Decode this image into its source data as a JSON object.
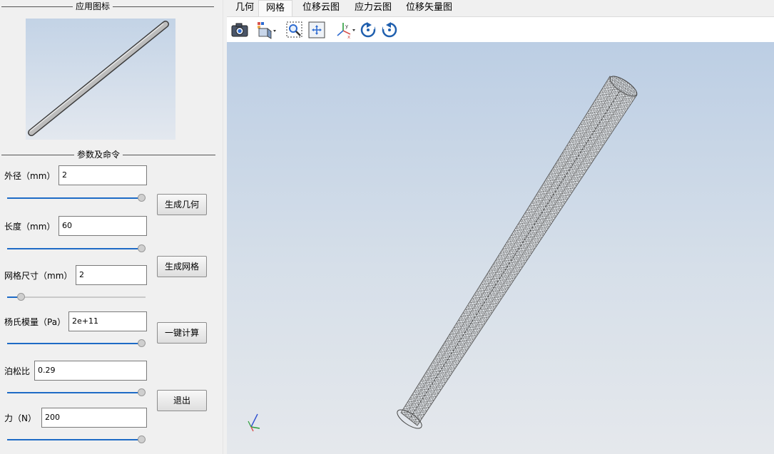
{
  "left_panel": {
    "icon_group_title": "应用图标",
    "params_group_title": "参数及命令",
    "params": {
      "outer_diameter": {
        "label": "外径（mm）",
        "value": "2",
        "slider_fraction": 1.0
      },
      "length": {
        "label": "长度（mm）",
        "value": "60",
        "slider_fraction": 1.0
      },
      "mesh_size": {
        "label": "网格尺寸（mm）",
        "value": "2",
        "slider_fraction": 0.1
      },
      "youngs_modulus": {
        "label": "杨氏模量（Pa）",
        "value": "2e+11",
        "slider_fraction": 1.0
      },
      "poisson_ratio": {
        "label": "泊松比",
        "value": "0.29",
        "slider_fraction": 1.0
      },
      "force": {
        "label": "力（N）",
        "value": "200",
        "slider_fraction": 1.0
      }
    },
    "buttons": {
      "generate_geometry": "生成几何",
      "generate_mesh": "生成网格",
      "compute": "一键计算",
      "exit": "退出"
    }
  },
  "tabs": [
    {
      "label": "几何",
      "active": false
    },
    {
      "label": "网格",
      "active": true
    },
    {
      "label": "位移云图",
      "active": false
    },
    {
      "label": "应力云图",
      "active": false
    },
    {
      "label": "位移矢量图",
      "active": false
    }
  ],
  "toolbar": [
    "camera-icon",
    "view-cube-icon",
    "zoom-box-icon",
    "fit-all-icon",
    "axes-icon",
    "rotate-left-icon",
    "rotate-right-icon"
  ],
  "colors": {
    "slider_fill": "#1e6bc6",
    "viewport_top": "#bccee4",
    "viewport_bottom": "#e5e8ec"
  }
}
